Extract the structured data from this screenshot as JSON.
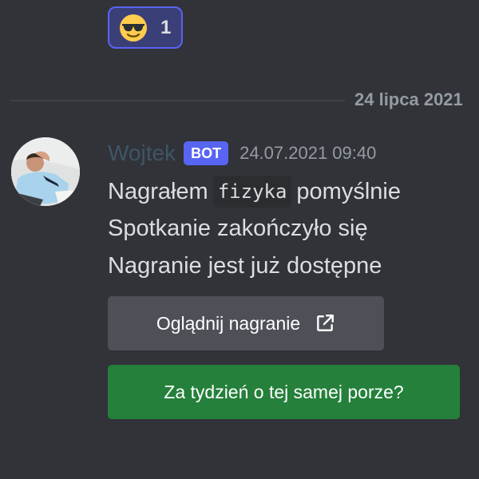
{
  "reaction": {
    "emoji": "sunglasses-emoji",
    "count": "1"
  },
  "divider": {
    "date": "24 lipca 2021"
  },
  "message": {
    "author": "Wojtek",
    "badge": "BOT",
    "timestamp": "24.07.2021 09:40",
    "line1_before": "Nagrałem",
    "line1_code": "fizyka",
    "line1_after": "pomyślnie",
    "line2": "Spotkanie zakończyło się",
    "line3": "Nagranie jest już dostępne"
  },
  "buttons": {
    "watch_label": "Oglądnij nagranie",
    "watch_icon": "external-link-icon",
    "week_label": "Za tydzień o tej samej porze?"
  },
  "colors": {
    "background": "#313338",
    "blurple": "#5865f2",
    "secondary_button": "#4e5058",
    "success_button": "#24803a",
    "author_name": "#3e5666"
  }
}
